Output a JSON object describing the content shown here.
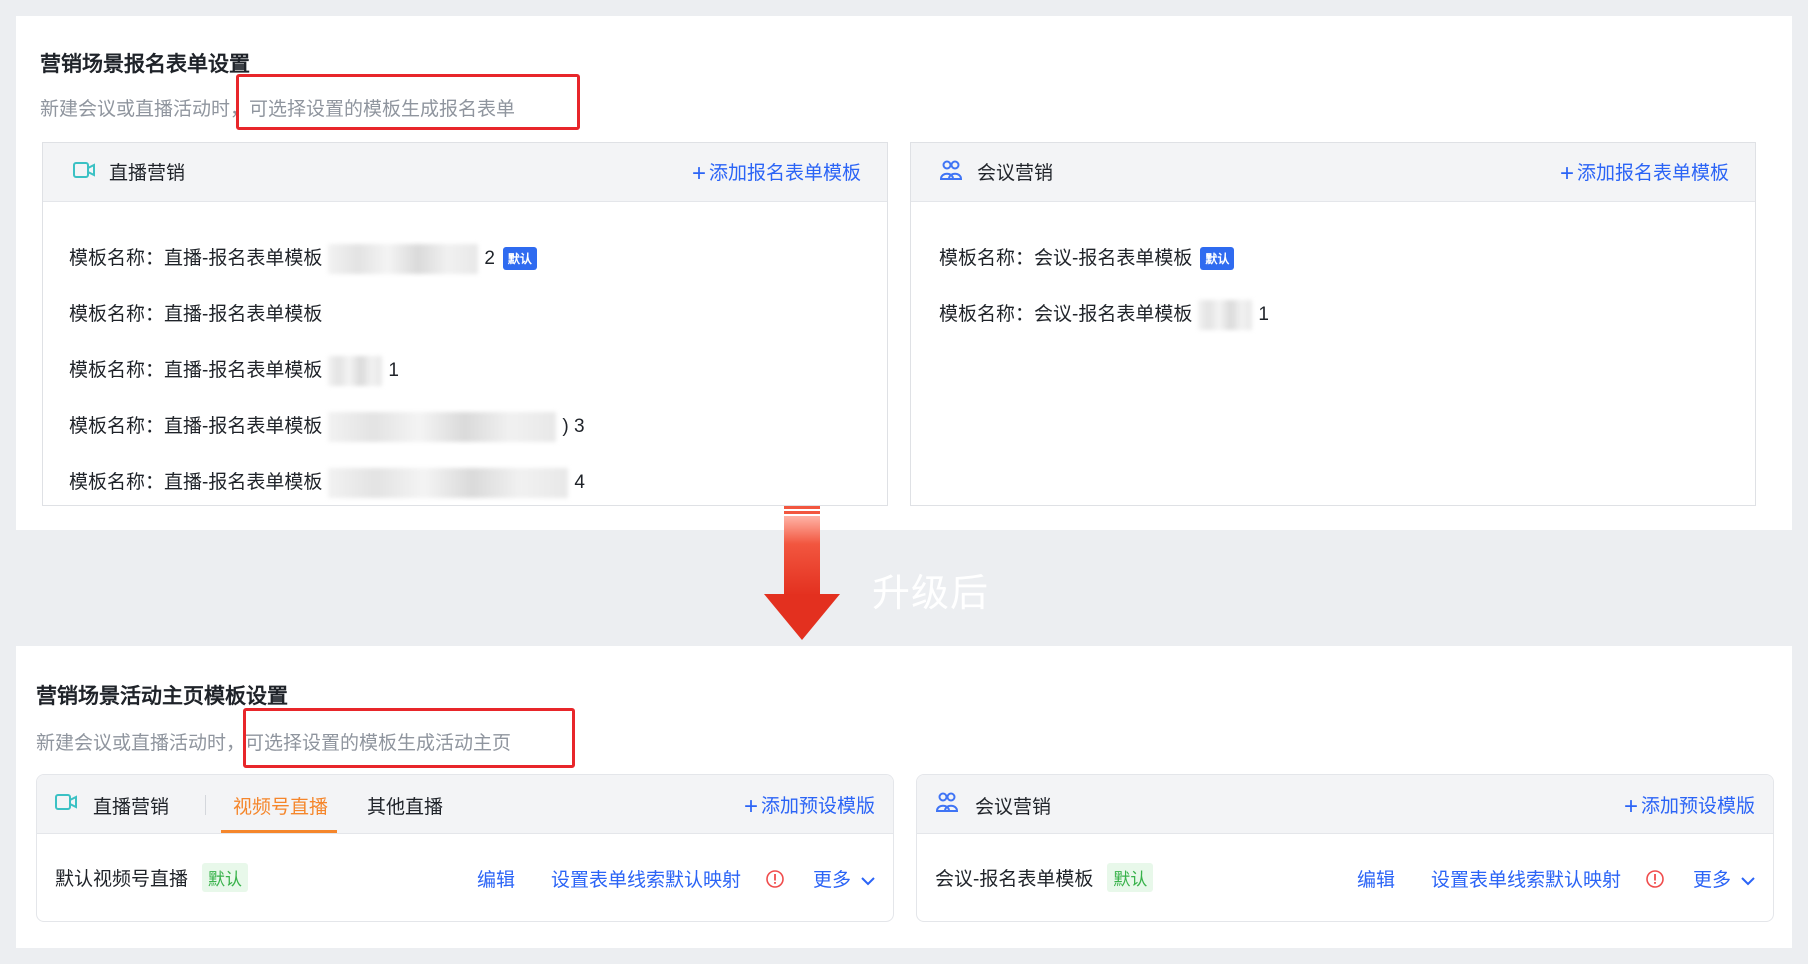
{
  "top": {
    "title": "营销场景报名表单设置",
    "subtitle_a": "新建会议或直播活动时，",
    "subtitle_b": "可选择设置的模板生成报名表单",
    "live_card": {
      "title": "直播营销",
      "add": "添加报名表单模板",
      "rows": [
        {
          "label": "模板名称：",
          "name": "直播-报名表单模板",
          "suffix": "2",
          "tag": "默认"
        },
        {
          "label": "模板名称：",
          "name": "直播-报名表单模板",
          "suffix": "",
          "tag": ""
        },
        {
          "label": "模板名称：",
          "name": "直播-报名表单模板",
          "suffix": "1",
          "tag": ""
        },
        {
          "label": "模板名称：",
          "name": "直播-报名表单模板",
          "suffix": ") 3",
          "tag": ""
        },
        {
          "label": "模板名称：",
          "name": "直播-报名表单模板",
          "suffix": "4",
          "tag": ""
        }
      ]
    },
    "meeting_card": {
      "title": "会议营销",
      "add": "添加报名表单模板",
      "rows": [
        {
          "label": "模板名称：",
          "name": "会议-报名表单模板",
          "suffix": "",
          "tag": "默认"
        },
        {
          "label": "模板名称：",
          "name": "会议-报名表单模板",
          "suffix": "1",
          "tag": ""
        }
      ]
    }
  },
  "upgrade_label": "升级后",
  "bottom": {
    "title": "营销场景活动主页模板设置",
    "subtitle_a": "新建会议或直播活动时，",
    "subtitle_b": "可选择设置的模板生成活动主页",
    "live_card": {
      "title": "直播营销",
      "tabs": [
        "视频号直播",
        "其他直播"
      ],
      "active_tab": 0,
      "add": "添加预设模版",
      "row": {
        "name": "默认视频号直播",
        "tag": "默认",
        "edit": "编辑",
        "mapping": "设置表单线索默认映射",
        "more": "更多"
      }
    },
    "meeting_card": {
      "title": "会议营销",
      "add": "添加预设模版",
      "row": {
        "name": "会议-报名表单模板",
        "tag": "默认",
        "edit": "编辑",
        "mapping": "设置表单线索默认映射",
        "more": "更多"
      }
    }
  },
  "colors": {
    "accent_blue": "#2b64f6",
    "active_orange": "#f5862b",
    "highlight_red": "#e8262a",
    "default_green": "#38b24a"
  }
}
